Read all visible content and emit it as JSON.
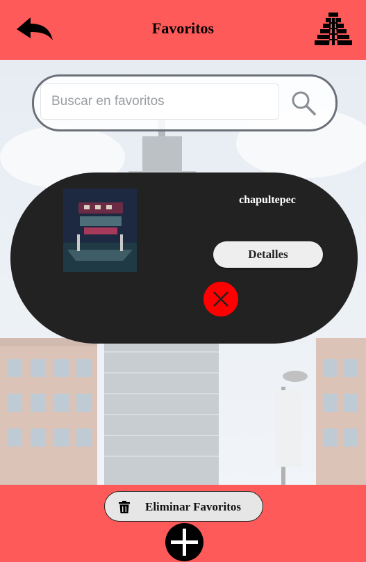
{
  "header": {
    "title": "Favoritos",
    "back_icon": "back-arrow-icon",
    "brand_icon": "pyramid-icon",
    "color": "#ff5a5a"
  },
  "search": {
    "placeholder": "Buscar en favoritos",
    "value": "",
    "icon": "search-icon"
  },
  "favorites": [
    {
      "name": "chapultepec",
      "details_label": "Detalles",
      "remove_icon": "close-icon"
    }
  ],
  "footer": {
    "clear_label": "Eliminar Favoritos",
    "clear_icon": "trash-icon",
    "add_icon": "plus-icon"
  },
  "colors": {
    "accent": "#ff5a5a",
    "card": "#222222",
    "remove": "#ff0000"
  }
}
